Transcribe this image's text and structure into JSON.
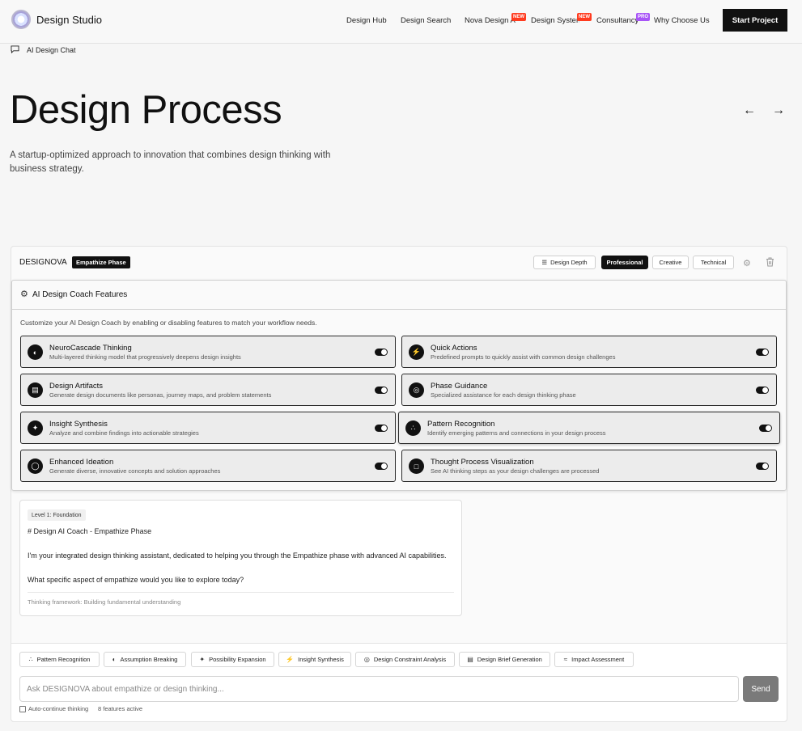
{
  "header": {
    "brand": "Design Studio",
    "nav": [
      {
        "label": "Design Hub",
        "badge": ""
      },
      {
        "label": "Design Search",
        "badge": ""
      },
      {
        "label": "Nova Design A",
        "badge": "NEW"
      },
      {
        "label": "Design Systen",
        "badge": "NEW"
      },
      {
        "label": "Consultancy",
        "badge": "PRO"
      },
      {
        "label": "Why Choose Us",
        "badge": ""
      }
    ],
    "cta": "Start Project"
  },
  "breadcrumb": {
    "label": "AI Design Chat"
  },
  "hero": {
    "title": "Design Process",
    "subtitle": "A startup-optimized approach to innovation that combines design thinking with business strategy.",
    "prev_icon": "arrow-left-icon",
    "next_icon": "arrow-right-icon"
  },
  "panel": {
    "brand": "DESIGNOVA",
    "phase_badge": "Empathize Phase",
    "depth_label": "Design Depth",
    "modes": [
      "Professional",
      "Creative",
      "Technical"
    ],
    "active_mode": "Professional"
  },
  "features": {
    "title": "AI Design Coach Features",
    "description": "Customize your AI Design Coach by enabling or disabling features to match your workflow needs.",
    "items": [
      {
        "name": "NeuroCascade Thinking",
        "desc": "Multi-layered thinking model that progressively deepens design insights",
        "icon": "brain-icon",
        "enabled": true
      },
      {
        "name": "Quick Actions",
        "desc": "Predefined prompts to quickly assist with common design challenges",
        "icon": "lightning-icon",
        "enabled": true
      },
      {
        "name": "Design Artifacts",
        "desc": "Generate design documents like personas, journey maps, and problem statements",
        "icon": "document-icon",
        "enabled": true
      },
      {
        "name": "Phase Guidance",
        "desc": "Specialized assistance for each design thinking phase",
        "icon": "target-icon",
        "enabled": true
      },
      {
        "name": "Insight Synthesis",
        "desc": "Analyze and combine findings into actionable strategies",
        "icon": "sparkles-icon",
        "enabled": true
      },
      {
        "name": "Pattern Recognition",
        "desc": "Identify emerging patterns and connections in your design process",
        "icon": "network-icon",
        "enabled": true
      },
      {
        "name": "Enhanced Ideation",
        "desc": "Generate diverse, innovative concepts and solution approaches",
        "icon": "lightbulb-icon",
        "enabled": true
      },
      {
        "name": "Thought Process Visualization",
        "desc": "See AI thinking steps as your design challenges are processed",
        "icon": "chat-icon",
        "enabled": true
      }
    ]
  },
  "message": {
    "level": "Level 1: Foundation",
    "heading": "# Design AI Coach - Empathize Phase",
    "intro": "I'm your integrated design thinking assistant, dedicated to helping you through the Empathize phase with advanced AI capabilities.",
    "question": "What specific aspect of empathize would you like to explore today?",
    "footer": "Thinking framework: Building fundamental understanding"
  },
  "quick_actions": [
    {
      "label": "Pattern Recognition",
      "icon": "network-icon"
    },
    {
      "label": "Assumption Breaking",
      "icon": "brain-icon"
    },
    {
      "label": "Possibility Expansion",
      "icon": "sparkles-icon"
    },
    {
      "label": "Insight Synthesis",
      "icon": "lightning-icon"
    },
    {
      "label": "Design Constraint Analysis",
      "icon": "target-icon"
    },
    {
      "label": "Design Brief Generation",
      "icon": "document-icon"
    },
    {
      "label": "Impact Assessment",
      "icon": "chart-icon"
    }
  ],
  "chat": {
    "placeholder": "Ask DESIGNOVA about empathize or design thinking...",
    "send": "Send",
    "auto_continue": "Auto-continue thinking",
    "features_active": "8 features active"
  }
}
